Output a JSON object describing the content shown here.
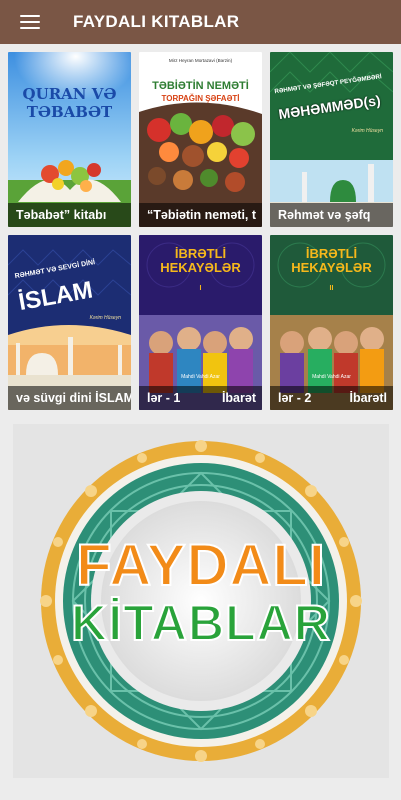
{
  "appbar": {
    "title": "FAYDALI KITABLAR",
    "menu_icon": "hamburger-menu-icon",
    "color": "#7a5645"
  },
  "books": [
    {
      "caption": "Təbabət” kitabı",
      "cover_title": [
        "QURAN VƏ",
        "TƏBABƏT"
      ]
    },
    {
      "caption": "“Təbiətin neməti, t",
      "cover_author": "Mirz Heyran Mortazavi (Bərzin)",
      "cover_title": [
        "TƏBİƏTİN NEMƏTİ",
        "TORPAĞIN ŞƏFAƏTİ"
      ]
    },
    {
      "caption": "Rəhmət və şəfq",
      "cover_title": [
        "RƏHMƏT VƏ ŞƏFƏQT PEYĞƏMBƏRİ",
        "MƏHƏMMƏD(s)"
      ],
      "cover_author": "Kərim Hüseyn"
    },
    {
      "caption": "və süvgi dini İSLAM",
      "cover_title": [
        "RƏHMƏT VƏ SEVGİ DİNİ",
        "İSLAM"
      ],
      "cover_author": "Kərim Hüseyn"
    },
    {
      "caption": "lər - 1",
      "caption_right": "İbarət",
      "cover_title": [
        "İBRƏTLİ",
        "HEKAYƏLƏR"
      ],
      "cover_number": "I",
      "cover_author": "Mahdi Vahdi Azar"
    },
    {
      "caption": "lər - 2",
      "caption_right": "İbarətl",
      "cover_title": [
        "İBRƏTLİ",
        "HEKAYƏLƏR"
      ],
      "cover_number": "II",
      "cover_author": "Mahdi Vahdi Azar"
    }
  ],
  "banner": {
    "line1": "FAYDALI",
    "line2": "KİTABLAR"
  }
}
